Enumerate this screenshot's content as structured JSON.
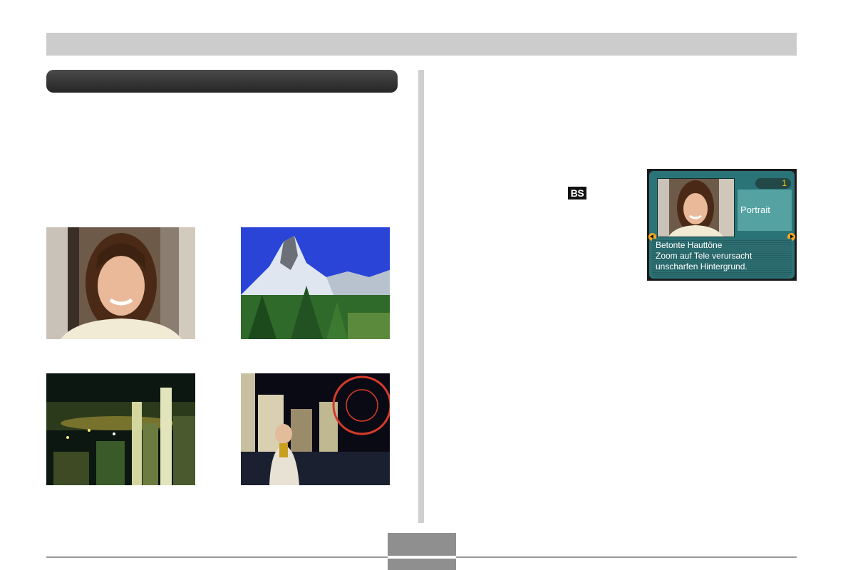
{
  "header": {
    "title": "",
    "section_title": ""
  },
  "scene_icon": {
    "label": "BS"
  },
  "lcd_screen": {
    "counter": "1",
    "mode_label": "Portrait",
    "description_lines": [
      "Betonte Hauttöne",
      "Zoom auf Tele verursacht",
      "unscharfen Hintergrund."
    ],
    "accent_color": "#f4a81f",
    "panel_color": "#2a7376"
  },
  "photos": [
    {
      "subject": "portrait-woman"
    },
    {
      "subject": "mountain-landscape"
    },
    {
      "subject": "night-cityscape"
    },
    {
      "subject": "night-portrait"
    }
  ],
  "footer": {
    "page_number": ""
  },
  "colors": {
    "header_band": "#cccccc",
    "section_header": "#333333",
    "divider": "#cfcfcf"
  }
}
